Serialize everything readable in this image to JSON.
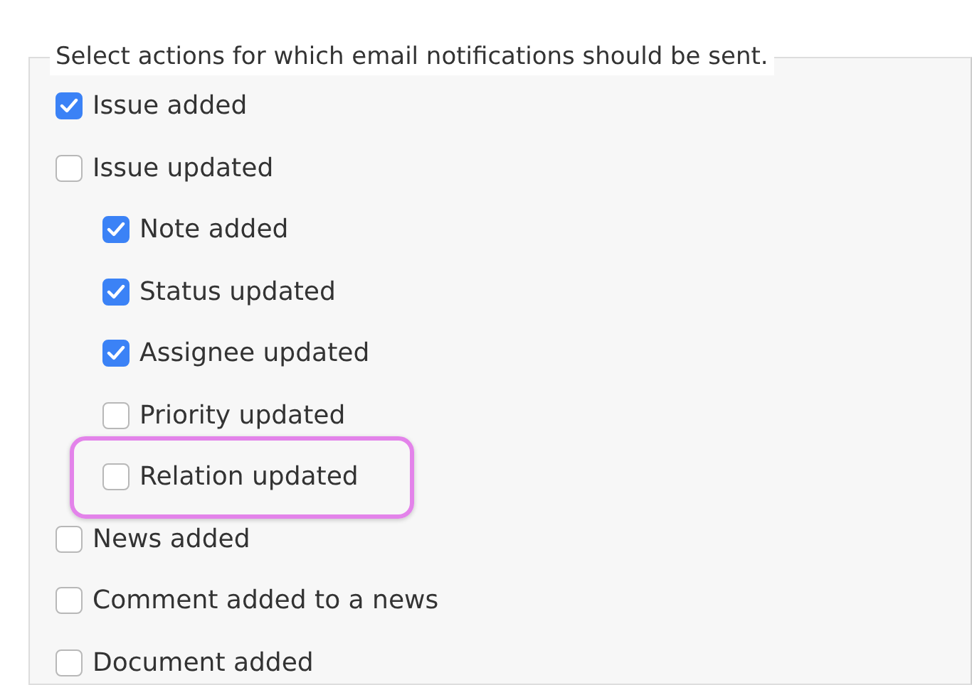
{
  "legend": "Select actions for which email notifications should be sent.",
  "items": [
    {
      "label": "Issue added",
      "checked": true
    },
    {
      "label": "Issue updated",
      "checked": false,
      "children": [
        {
          "label": "Note added",
          "checked": true,
          "highlighted": false
        },
        {
          "label": "Status updated",
          "checked": true,
          "highlighted": false
        },
        {
          "label": "Assignee updated",
          "checked": true,
          "highlighted": false
        },
        {
          "label": "Priority updated",
          "checked": false,
          "highlighted": false
        },
        {
          "label": "Relation updated",
          "checked": false,
          "highlighted": true
        }
      ]
    },
    {
      "label": "News added",
      "checked": false
    },
    {
      "label": "Comment added to a news",
      "checked": false
    },
    {
      "label": "Document added",
      "checked": false
    }
  ]
}
